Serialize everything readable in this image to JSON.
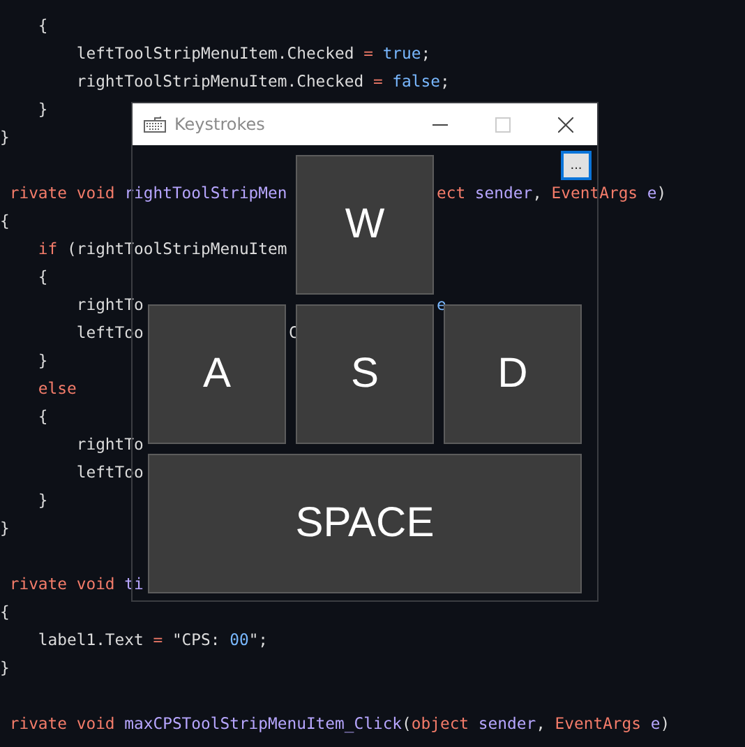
{
  "code_lines": [
    {
      "segments": [
        {
          "kind": "left",
          "tokens": [
            {
              "text": "    {",
              "kind": "plain"
            }
          ]
        }
      ]
    },
    {
      "segments": [
        {
          "kind": "left",
          "tokens": [
            {
              "text": "        leftToolStripMenuItem.Checked",
              "kind": "plain"
            },
            {
              "text": " =",
              "kind": "op"
            },
            {
              "text": " true",
              "kind": "lit"
            },
            {
              "text": ";",
              "kind": "plain"
            }
          ]
        }
      ]
    },
    {
      "segments": [
        {
          "kind": "left",
          "tokens": [
            {
              "text": "        rightToolStripMenuItem.Checked",
              "kind": "plain"
            },
            {
              "text": " =",
              "kind": "op"
            },
            {
              "text": " false",
              "kind": "lit"
            },
            {
              "text": ";",
              "kind": "plain"
            }
          ]
        }
      ]
    },
    {
      "segments": [
        {
          "kind": "left",
          "tokens": [
            {
              "text": "    }",
              "kind": "plain"
            }
          ]
        }
      ]
    },
    {
      "segments": [
        {
          "kind": "left",
          "tokens": [
            {
              "text": "}",
              "kind": "plain"
            }
          ]
        }
      ]
    },
    {
      "blank_before": true,
      "segments": [
        {
          "kind": "left",
          "tokens": [
            {
              "text": " rivate void",
              "kind": "kw"
            },
            {
              "text": " rightToolStripMen",
              "kind": "fn"
            }
          ]
        },
        {
          "kind": "right_of_w",
          "tokens": [
            {
              "text": "ect",
              "kind": "kw"
            },
            {
              "text": " sender",
              "kind": "fn"
            },
            {
              "text": ",",
              "kind": "plain"
            },
            {
              "text": " EventArgs",
              "kind": "kw"
            },
            {
              "text": " e",
              "kind": "fn"
            },
            {
              "text": ")",
              "kind": "plain"
            }
          ]
        }
      ]
    },
    {
      "segments": [
        {
          "kind": "left",
          "tokens": [
            {
              "text": "{",
              "kind": "plain"
            }
          ]
        }
      ]
    },
    {
      "segments": [
        {
          "kind": "left",
          "tokens": [
            {
              "text": "    if",
              "kind": "kw"
            },
            {
              "text": " (rightToolStripMenuItem",
              "kind": "plain"
            }
          ]
        }
      ]
    },
    {
      "segments": [
        {
          "kind": "left",
          "tokens": [
            {
              "text": "    {",
              "kind": "plain"
            }
          ]
        }
      ]
    },
    {
      "segments": [
        {
          "kind": "left",
          "tokens": [
            {
              "text": "        rightTo",
              "kind": "plain"
            }
          ]
        },
        {
          "kind": "right_of_s",
          "tokens": [
            {
              "text": "e",
              "kind": "lit"
            }
          ]
        }
      ]
    },
    {
      "segments": [
        {
          "kind": "left",
          "tokens": [
            {
              "text": "        leftToo",
              "kind": "plain"
            }
          ]
        },
        {
          "kind": "right_of_a",
          "tokens": [
            {
              "text": "C",
              "kind": "plain"
            }
          ]
        }
      ]
    },
    {
      "segments": [
        {
          "kind": "left",
          "tokens": [
            {
              "text": "    }",
              "kind": "plain"
            }
          ]
        }
      ]
    },
    {
      "segments": [
        {
          "kind": "left",
          "tokens": [
            {
              "text": "    else",
              "kind": "kw"
            }
          ]
        }
      ]
    },
    {
      "segments": [
        {
          "kind": "left",
          "tokens": [
            {
              "text": "    {",
              "kind": "plain"
            }
          ]
        }
      ]
    },
    {
      "segments": [
        {
          "kind": "left",
          "tokens": [
            {
              "text": "        rightTo",
              "kind": "plain"
            }
          ]
        }
      ]
    },
    {
      "segments": [
        {
          "kind": "left",
          "tokens": [
            {
              "text": "        leftToo",
              "kind": "plain"
            }
          ]
        }
      ]
    },
    {
      "segments": [
        {
          "kind": "left",
          "tokens": [
            {
              "text": "    }",
              "kind": "plain"
            }
          ]
        }
      ]
    },
    {
      "segments": [
        {
          "kind": "left",
          "tokens": [
            {
              "text": "}",
              "kind": "plain"
            }
          ]
        }
      ]
    },
    {
      "blank_before": true,
      "segments": [
        {
          "kind": "left",
          "tokens": [
            {
              "text": " rivate void",
              "kind": "kw"
            },
            {
              "text": " ti",
              "kind": "fn"
            }
          ]
        }
      ]
    },
    {
      "segments": [
        {
          "kind": "left",
          "tokens": [
            {
              "text": "{",
              "kind": "plain"
            }
          ]
        }
      ]
    },
    {
      "segments": [
        {
          "kind": "left",
          "tokens": [
            {
              "text": "    label1.Text",
              "kind": "plain"
            },
            {
              "text": " =",
              "kind": "op"
            },
            {
              "text": " \"CPS:",
              "kind": "plain"
            },
            {
              "text": " 00",
              "kind": "lit"
            },
            {
              "text": "\";",
              "kind": "plain"
            }
          ]
        }
      ]
    },
    {
      "segments": [
        {
          "kind": "left",
          "tokens": [
            {
              "text": "}",
              "kind": "plain"
            }
          ]
        }
      ]
    },
    {
      "blank_before": true,
      "segments": [
        {
          "kind": "left",
          "tokens": [
            {
              "text": " rivate void",
              "kind": "kw"
            },
            {
              "text": " maxCPSToolStripMenuItem_Click",
              "kind": "fn"
            },
            {
              "text": "(",
              "kind": "plain"
            },
            {
              "text": "object",
              "kind": "kw"
            },
            {
              "text": " sender",
              "kind": "fn"
            },
            {
              "text": ",",
              "kind": "plain"
            },
            {
              "text": " EventArgs",
              "kind": "kw"
            },
            {
              "text": " e",
              "kind": "fn"
            },
            {
              "text": ")",
              "kind": "plain"
            }
          ]
        }
      ]
    }
  ],
  "window": {
    "title": "Keystrokes",
    "options_button": "...",
    "key_rows": [
      [
        {
          "label": "W",
          "kind": "square"
        }
      ],
      [
        {
          "label": "A",
          "kind": "square"
        },
        {
          "label": "S",
          "kind": "square"
        },
        {
          "label": "D",
          "kind": "square"
        }
      ],
      [
        {
          "label": "SPACE",
          "kind": "wide"
        }
      ]
    ]
  }
}
